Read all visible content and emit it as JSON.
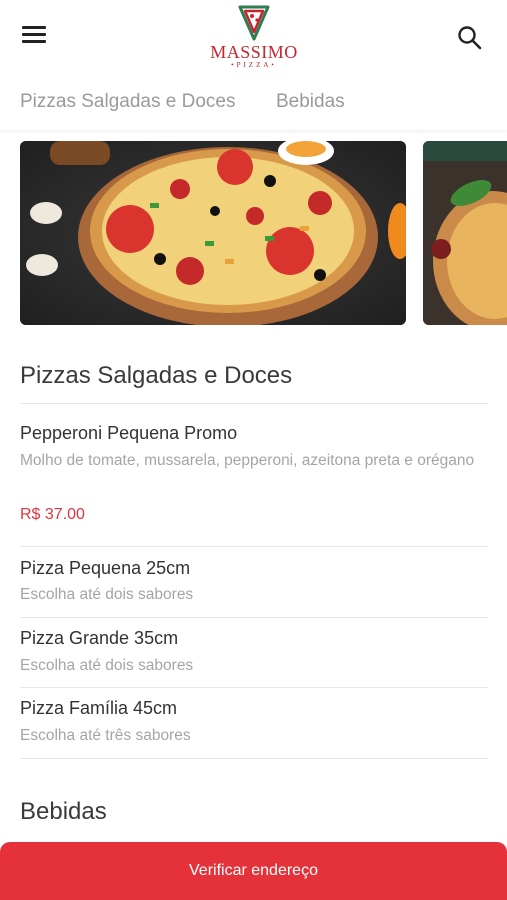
{
  "header": {
    "logo_name": "MASSIMO",
    "logo_sub": "•PIZZA•",
    "brand_color": "#c4262e"
  },
  "tabs": [
    {
      "label": "Pizzas Salgadas e Doces"
    },
    {
      "label": "Bebidas"
    }
  ],
  "sections": [
    {
      "title": "Pizzas Salgadas e Doces",
      "items": [
        {
          "name": "Pepperoni Pequena Promo",
          "description": "Molho de tomate, mussarela, pepperoni, azeitona preta e orégano",
          "price": "R$ 37.00"
        },
        {
          "name": "Pizza Pequena 25cm",
          "description": "Escolha até dois sabores"
        },
        {
          "name": "Pizza Grande 35cm",
          "description": "Escolha até dois sabores"
        },
        {
          "name": "Pizza Família 45cm",
          "description": "Escolha até três sabores"
        }
      ]
    },
    {
      "title": "Bebidas"
    }
  ],
  "cta": {
    "label": "Verificar endereço",
    "color": "#e5323a"
  },
  "icons": {
    "menu": "hamburger-menu-icon",
    "search": "search-icon"
  }
}
